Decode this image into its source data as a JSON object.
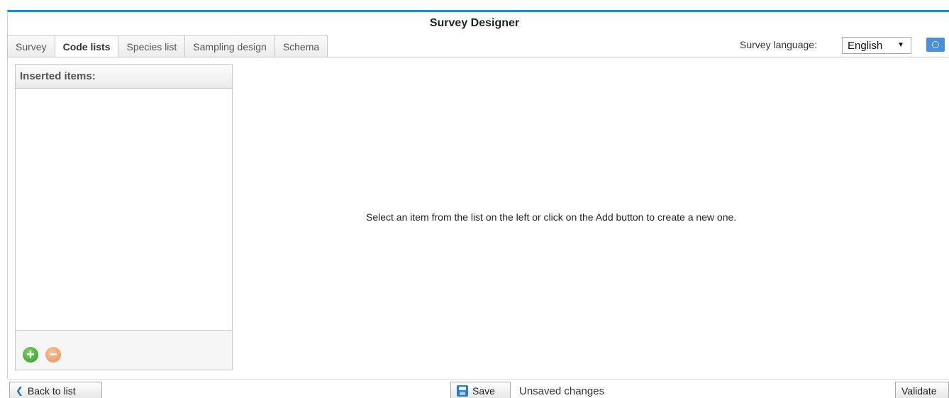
{
  "header": {
    "title": "Survey Designer"
  },
  "tabs": [
    {
      "label": "Survey",
      "active": false
    },
    {
      "label": "Code lists",
      "active": true
    },
    {
      "label": "Species list",
      "active": false
    },
    {
      "label": "Sampling design",
      "active": false
    },
    {
      "label": "Schema",
      "active": false
    }
  ],
  "language": {
    "label": "Survey language:",
    "selected": "English",
    "icon": "globe-flag-icon"
  },
  "sidebar": {
    "header": "Inserted items:",
    "add_icon": "plus-circle-icon",
    "remove_icon": "minus-circle-icon"
  },
  "main": {
    "placeholder": "Select an item from the list on the left or click on the Add button to create a new one."
  },
  "footer": {
    "back_label": "Back to list",
    "save_label": "Save",
    "status": "Unsaved changes",
    "validate_label": "Validate"
  },
  "colors": {
    "accent": "#1a8ccf",
    "add": "#2f9a1f",
    "remove": "#e8955a"
  }
}
